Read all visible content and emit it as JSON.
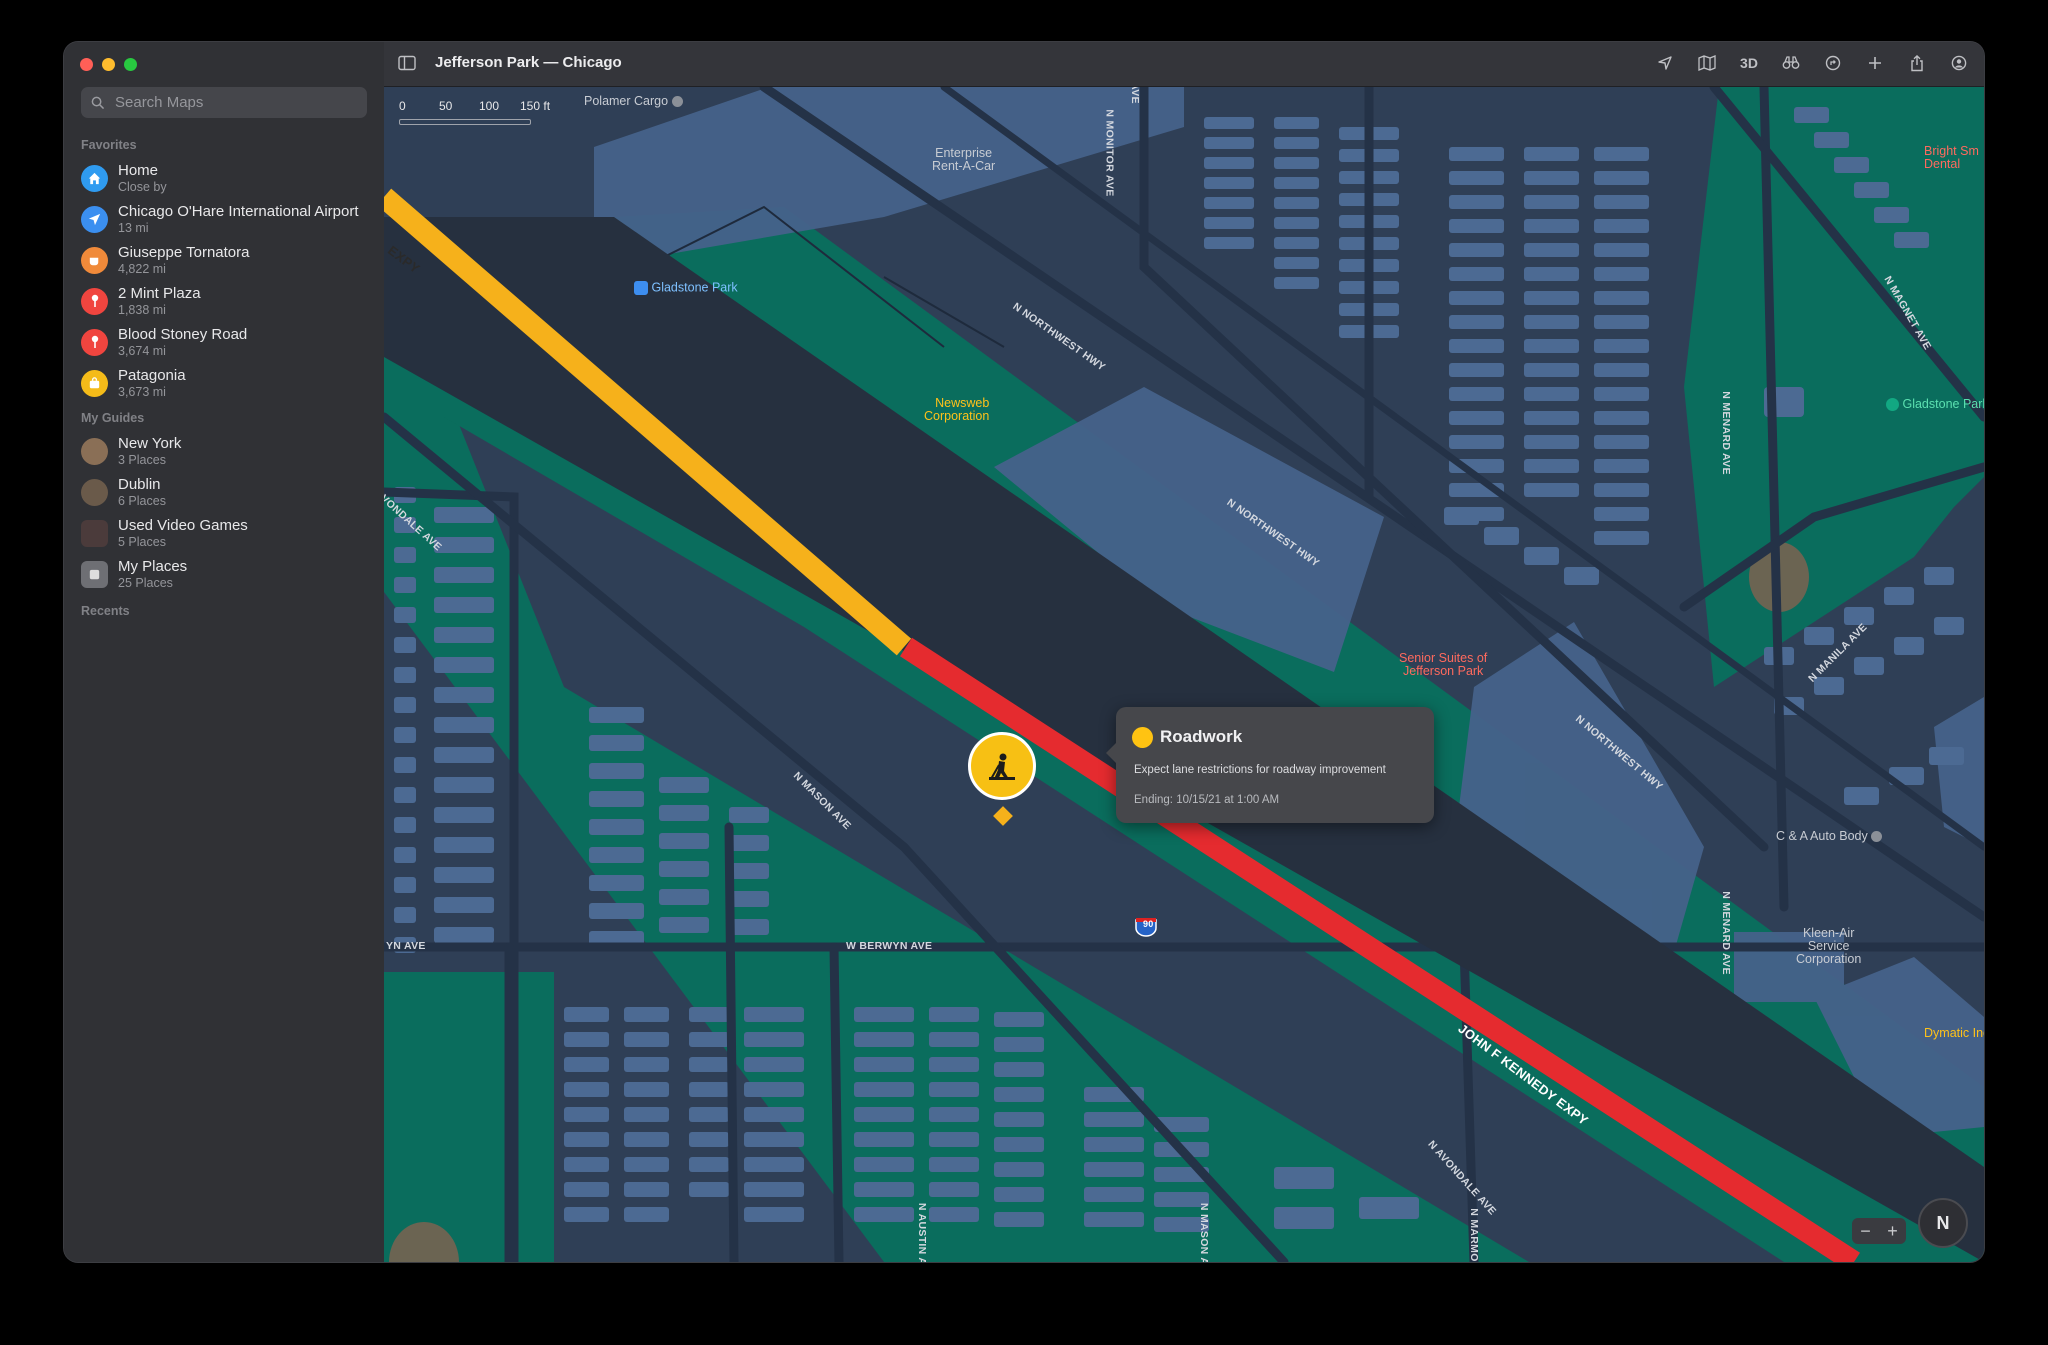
{
  "window": {
    "title": "Jefferson Park — Chicago"
  },
  "search": {
    "placeholder": "Search Maps"
  },
  "sidebar": {
    "favorites_heading": "Favorites",
    "favorites": [
      {
        "name": "Home",
        "sub": "Close by",
        "color": "#2f9bf0",
        "icon": "house-icon"
      },
      {
        "name": "Chicago O'Hare International Airport",
        "sub": "13 mi",
        "color": "#3b8ff0",
        "icon": "airplane-icon"
      },
      {
        "name": "Giuseppe Tornatora",
        "sub": "4,822 mi",
        "color": "#f08a3a",
        "icon": "cup-icon"
      },
      {
        "name": "2 Mint Plaza",
        "sub": "1,838 mi",
        "color": "#f0453f",
        "icon": "pin-icon"
      },
      {
        "name": "Blood Stoney Road",
        "sub": "3,674 mi",
        "color": "#f0453f",
        "icon": "pin-icon"
      },
      {
        "name": "Patagonia",
        "sub": "3,673 mi",
        "color": "#f4bb19",
        "icon": "bag-icon"
      }
    ],
    "guides_heading": "My Guides",
    "guides": [
      {
        "name": "New York",
        "sub": "3 Places",
        "color": "#8a6f56"
      },
      {
        "name": "Dublin",
        "sub": "6 Places",
        "color": "#6a5a4a"
      },
      {
        "name": "Used Video Games",
        "sub": "5 Places",
        "color": "#4b3b3b"
      },
      {
        "name": "My Places",
        "sub": "25 Places",
        "color": "#6e6f74"
      }
    ],
    "recents_heading": "Recents"
  },
  "toolbar": {
    "view3d": "3D"
  },
  "map": {
    "scale": [
      "0",
      "50",
      "100",
      "150 ft"
    ],
    "labels": {
      "polamer": "Polamer Cargo",
      "enterprise": "Enterprise\nRent-A-Car",
      "gladstone1": "Gladstone Park",
      "gladstone2": "Gladstone Park",
      "newsweb": "Newsweb\nCorporation",
      "senior": "Senior Suites of\nJefferson Park",
      "bright": "Bright Sm\nDental",
      "candA": "C & A Auto Body",
      "kleen": "Kleen-Air\nService\nCorporation",
      "dymatic": "Dymatic Inc",
      "nw_hwy1": "N NORTHWEST HWY",
      "nw_hwy2": "N NORTHWEST HWY",
      "nw_hwy3": "N NORTHWEST HWY",
      "monitor": "N MONITOR AVE",
      "menard1": "N MENARD AVE",
      "menard2": "N MENARD AVE",
      "magnet": "N MAGNET AVE",
      "manila": "N MANILA AVE",
      "avondale1": "VONDALE AVE",
      "avondale2": "N AVONDALE AVE",
      "mason1": "N MASON AVE",
      "mason2": "N MASON AVE",
      "berwyn1": "YN AVE",
      "berwyn2": "W BERWYN AVE",
      "austin": "N AUSTIN AVE",
      "marmora": "N MARMORA A",
      "kennedy": "JOHN F KENNEDY EXPY",
      "expy": "EXPY",
      "ave_top": "AVE",
      "i90": "90"
    },
    "callout": {
      "title": "Roadwork",
      "description": "Expect lane restrictions for roadway improvement",
      "ending": "Ending: 10/15/21 at 1:00 AM"
    },
    "compass": "N",
    "zoom_out": "−",
    "zoom_in": "+"
  }
}
